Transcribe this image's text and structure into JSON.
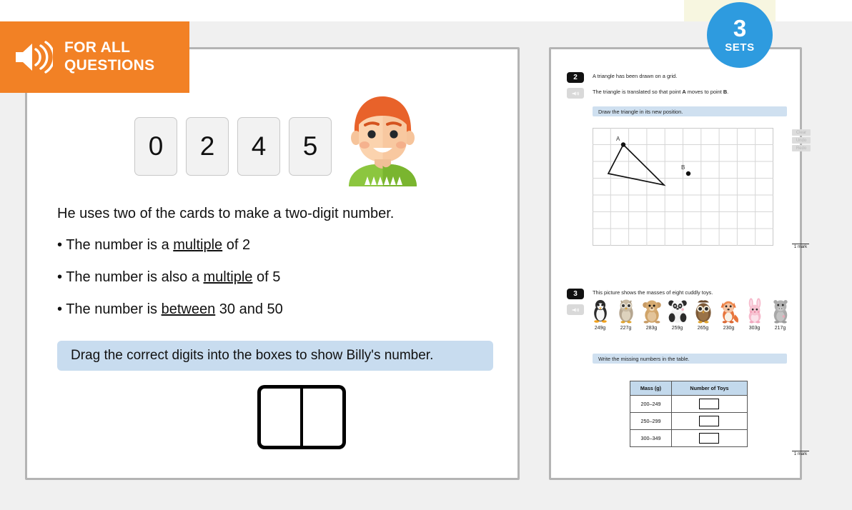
{
  "banner": {
    "line1": "FOR ALL",
    "line2": "QUESTIONS",
    "icon": "speaker-icon",
    "color": "#f28125"
  },
  "badge": {
    "number": "3",
    "label": "SETS",
    "color": "#2e9bdf"
  },
  "left_question": {
    "cards": [
      "0",
      "2",
      "4",
      "5"
    ],
    "avatar_alt": "boy-avatar",
    "stem": "He uses two of the cards to make a two-digit number.",
    "bullets": [
      {
        "pre": "• The number is a ",
        "keyword": "multiple",
        "post": " of 2"
      },
      {
        "pre": "• The number is also a ",
        "keyword": "multiple",
        "post": " of 5"
      },
      {
        "pre": "• The number is ",
        "keyword": "between",
        "post": " 30 and 50"
      }
    ],
    "instruction": "Drag the correct digits into the boxes to show Billy's number.",
    "answer_boxes": [
      "",
      ""
    ],
    "instruction_bg": "#c8dcef"
  },
  "right_panel": {
    "question2": {
      "number": "2",
      "line1": "A triangle has been drawn on a grid.",
      "line2_pre": "The triangle is translated so that point ",
      "line2_a": "A",
      "line2_mid": " moves to point ",
      "line2_b": "B",
      "line2_post": ".",
      "instruction": "Draw the triangle in its new position.",
      "point_a_label": "A",
      "point_b_label": "B",
      "tools": [
        "Clear",
        "Undo",
        "Redo"
      ],
      "mark": "1 mark"
    },
    "question3": {
      "number": "3",
      "line1": "This picture shows the masses of eight cuddly toys.",
      "instruction": "Write the missing numbers in the table.",
      "toys": [
        {
          "name": "penguin",
          "mass": "249g"
        },
        {
          "name": "grey-owl",
          "mass": "227g"
        },
        {
          "name": "teddy-bear",
          "mass": "283g"
        },
        {
          "name": "panda",
          "mass": "259g"
        },
        {
          "name": "brown-owl",
          "mass": "265g"
        },
        {
          "name": "fox",
          "mass": "230g"
        },
        {
          "name": "rabbit",
          "mass": "303g"
        },
        {
          "name": "hippo",
          "mass": "217g"
        }
      ],
      "table": {
        "headers": [
          "Mass (g)",
          "Number of Toys"
        ],
        "rows": [
          {
            "range": "200–249",
            "count": ""
          },
          {
            "range": "250–299",
            "count": ""
          },
          {
            "range": "300–349",
            "count": ""
          }
        ]
      },
      "mark": "1 mark"
    }
  }
}
